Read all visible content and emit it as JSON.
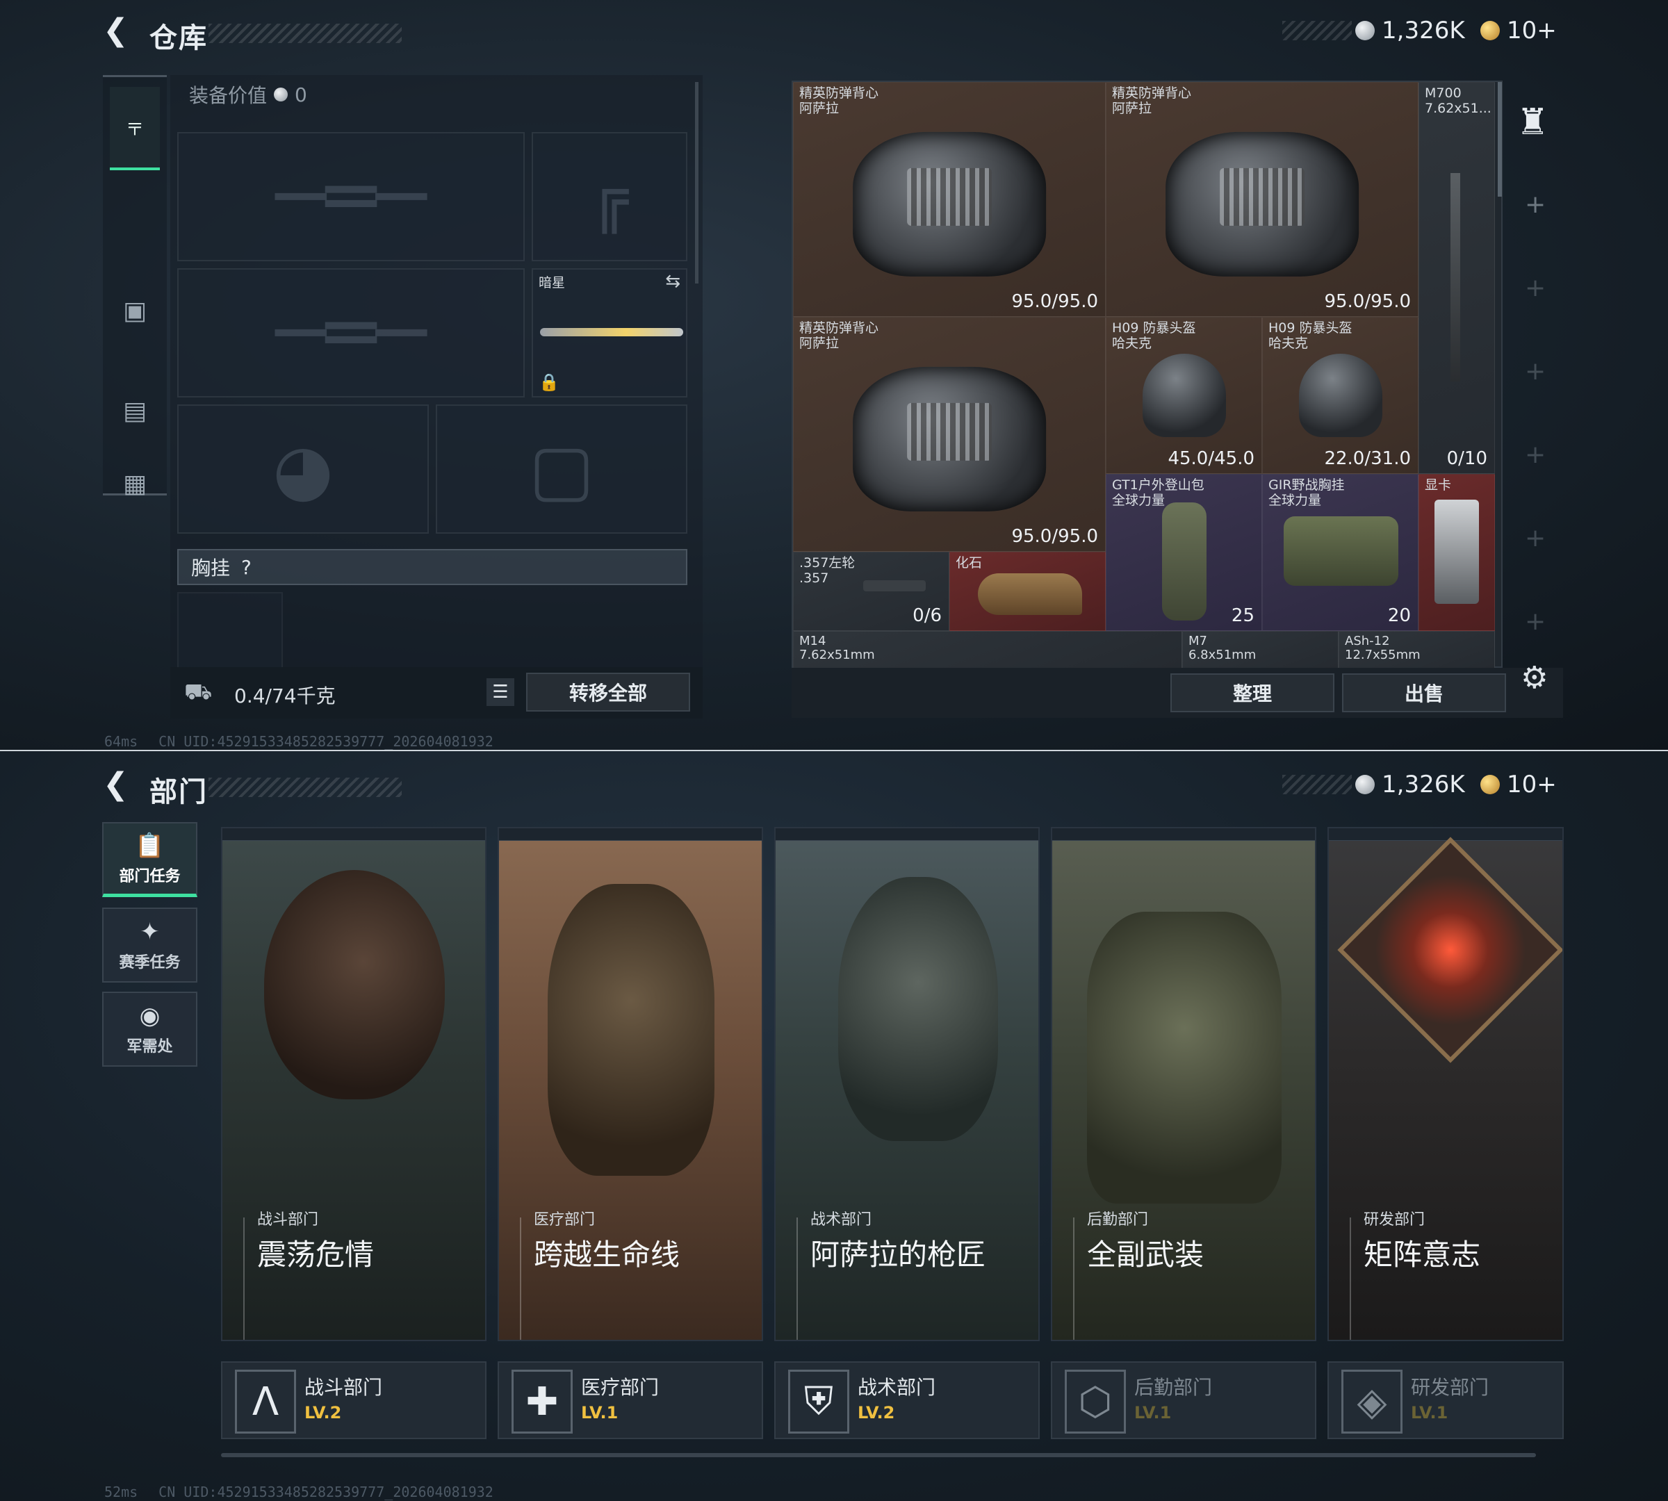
{
  "warehouse": {
    "title": "仓库",
    "currency": {
      "silver": "1,326K",
      "gold": "10+"
    },
    "equip_value_label": "装备价值",
    "equip_value": "0",
    "melee_slot_label": "暗星",
    "chest_rig_label": "胸挂",
    "chest_rig_help": "?",
    "weight": "0.4/74千克",
    "transfer_all": "转移全部",
    "sort_button": "整理",
    "sell_button": "出售",
    "items": [
      {
        "name": "精英防弹背心\n阿萨拉",
        "value": "95.0/95.0"
      },
      {
        "name": "精英防弹背心\n阿萨拉",
        "value": "95.0/95.0"
      },
      {
        "name": "M700\n7.62x51...",
        "value": "0/10"
      },
      {
        "name": "精英防弹背心\n阿萨拉",
        "value": "95.0/95.0"
      },
      {
        "name": "H09 防暴头盔\n哈夫克",
        "value": "45.0/45.0"
      },
      {
        "name": "H09 防暴头盔\n哈夫克",
        "value": "22.0/31.0"
      },
      {
        "name": "GT1户外登山包\n全球力量",
        "value": "25"
      },
      {
        "name": "GIR野战胸挂\n全球力量",
        "value": "20"
      },
      {
        "name": "显卡",
        "value": ""
      },
      {
        "name": ".357左轮\n.357",
        "value": "0/6"
      },
      {
        "name": "化石",
        "value": ""
      },
      {
        "name": "M14\n7.62x51mm",
        "value": ""
      },
      {
        "name": "M7\n6.8x51mm",
        "value": ""
      },
      {
        "name": "ASh-12\n12.7x55mm",
        "value": ""
      }
    ],
    "footer": {
      "ping": "64ms",
      "uid": "CN UID:452915334852825397​77_202604081932"
    }
  },
  "department": {
    "title": "部门",
    "currency": {
      "silver": "1,326K",
      "gold": "10+"
    },
    "tabs": [
      {
        "label": "部门任务",
        "icon": "task-clipboard-icon"
      },
      {
        "label": "赛季任务",
        "icon": "season-icon"
      },
      {
        "label": "军需处",
        "icon": "supply-coins-icon"
      }
    ],
    "cards": [
      {
        "dept": "战斗部门",
        "name": "震荡危情"
      },
      {
        "dept": "医疗部门",
        "name": "跨越生命线"
      },
      {
        "dept": "战术部门",
        "name": "阿萨拉的枪匠"
      },
      {
        "dept": "后勤部门",
        "name": "全副武装"
      },
      {
        "dept": "研发部门",
        "name": "矩阵意志"
      }
    ],
    "tiles": [
      {
        "name": "战斗部门",
        "level": "LV.2"
      },
      {
        "name": "医疗部门",
        "level": "LV.1"
      },
      {
        "name": "战术部门",
        "level": "LV.2"
      },
      {
        "name": "后勤部门",
        "level": "LV.1"
      },
      {
        "name": "研发部门",
        "level": "LV.1"
      }
    ],
    "footer": {
      "ping": "52ms",
      "uid": "CN UID:452915334852825397​77_202604081932"
    }
  },
  "colors": {
    "accent": "#3ee0a0",
    "level": "#f0c040"
  }
}
